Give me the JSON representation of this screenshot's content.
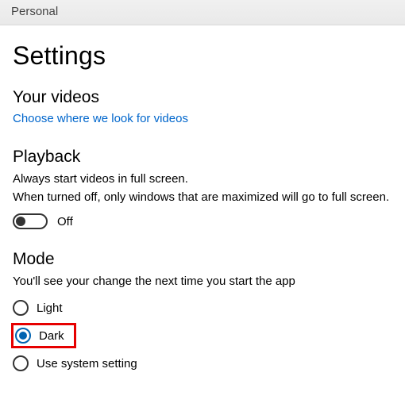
{
  "window": {
    "title": "Personal"
  },
  "page": {
    "title": "Settings"
  },
  "sections": {
    "videos": {
      "heading": "Your videos",
      "link": "Choose where we look for videos"
    },
    "playback": {
      "heading": "Playback",
      "line1": "Always start videos in full screen.",
      "line2": "When turned off, only windows that are maximized will go to full screen.",
      "toggle_state": "off",
      "toggle_label": "Off"
    },
    "mode": {
      "heading": "Mode",
      "hint": "You'll see your change the next time you start the app",
      "options": {
        "light": "Light",
        "dark": "Dark",
        "system": "Use system setting"
      },
      "selected": "dark"
    }
  }
}
